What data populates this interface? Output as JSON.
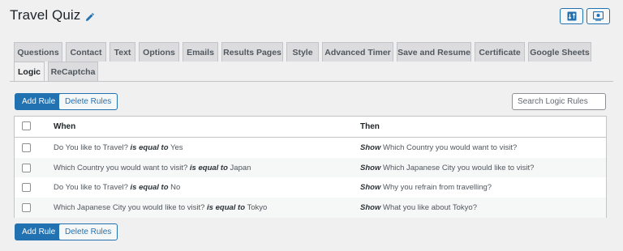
{
  "header": {
    "title": "Travel Quiz",
    "edit_icon": "pencil-icon",
    "actions": [
      {
        "icon": "sort-icon"
      },
      {
        "icon": "preview-icon"
      }
    ]
  },
  "tabs": {
    "row1": [
      "Questions",
      "Contact",
      "Text",
      "Options",
      "Emails",
      "Results Pages",
      "Style",
      "Advanced Timer",
      "Save and Resume",
      "Certificate",
      "Google Sheets"
    ],
    "row2": [
      "Logic",
      "ReCaptcha"
    ],
    "active": "Logic"
  },
  "toolbar": {
    "add_rule": "Add Rule",
    "delete_rules": "Delete Rules",
    "search_placeholder": "Search Logic Rules"
  },
  "table": {
    "headers": {
      "when": "When",
      "then": "Then"
    },
    "rows": [
      {
        "when_q": "Do You like to Travel?",
        "operator": "is equal to",
        "when_v": "Yes",
        "action": "Show",
        "then_text": "Which Country you would want to visit?"
      },
      {
        "when_q": "Which Country you would want to visit?",
        "operator": "is equal to",
        "when_v": "Japan",
        "action": "Show",
        "then_text": "Which Japanese City you would like to visit?"
      },
      {
        "when_q": "Do You like to Travel?",
        "operator": "is equal to",
        "when_v": "No",
        "action": "Show",
        "then_text": "Why you refrain from travelling?"
      },
      {
        "when_q": "Which Japanese City you would like to visit?",
        "operator": "is equal to",
        "when_v": "Tokyo",
        "action": "Show",
        "then_text": "What you like about Tokyo?"
      }
    ]
  },
  "colors": {
    "primary": "#2271b1",
    "background": "#f0f0f1",
    "border": "#c3c4c7"
  }
}
